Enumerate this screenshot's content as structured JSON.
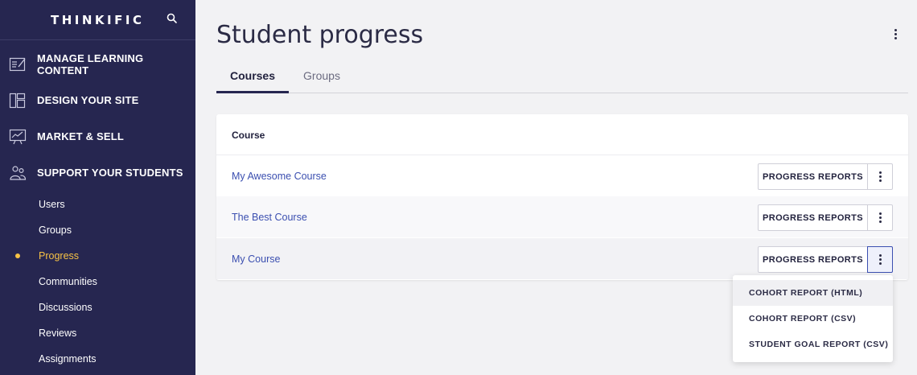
{
  "brand": {
    "logo": "THINKIFIC",
    "search_icon": "search-icon"
  },
  "sidebar": {
    "sections": [
      {
        "label": "MANAGE LEARNING CONTENT",
        "icon": "edit-content-icon"
      },
      {
        "label": "DESIGN YOUR SITE",
        "icon": "layout-icon"
      },
      {
        "label": "MARKET & SELL",
        "icon": "presentation-chart-icon"
      },
      {
        "label": "SUPPORT YOUR STUDENTS",
        "icon": "users-icon"
      }
    ],
    "sub_items": [
      {
        "label": "Users",
        "active": false
      },
      {
        "label": "Groups",
        "active": false
      },
      {
        "label": "Progress",
        "active": true
      },
      {
        "label": "Communities",
        "active": false
      },
      {
        "label": "Discussions",
        "active": false
      },
      {
        "label": "Reviews",
        "active": false
      },
      {
        "label": "Assignments",
        "active": false
      }
    ]
  },
  "header": {
    "title": "Student progress",
    "menu_icon": "kebab-icon"
  },
  "tabs": [
    {
      "label": "Courses",
      "selected": true
    },
    {
      "label": "Groups",
      "selected": false
    }
  ],
  "table": {
    "column_header": "Course",
    "rows": [
      {
        "course": "My Awesome Course",
        "button": "PROGRESS REPORTS"
      },
      {
        "course": "The Best Course",
        "button": "PROGRESS REPORTS"
      },
      {
        "course": "My Course",
        "button": "PROGRESS REPORTS"
      }
    ]
  },
  "dropdown": {
    "items": [
      "COHORT REPORT (HTML)",
      "COHORT REPORT (CSV)",
      "STUDENT GOAL REPORT (CSV)"
    ]
  },
  "colors": {
    "sidebar_bg": "#262650",
    "accent_active": "#f7c245",
    "link": "#3b4fb0"
  }
}
